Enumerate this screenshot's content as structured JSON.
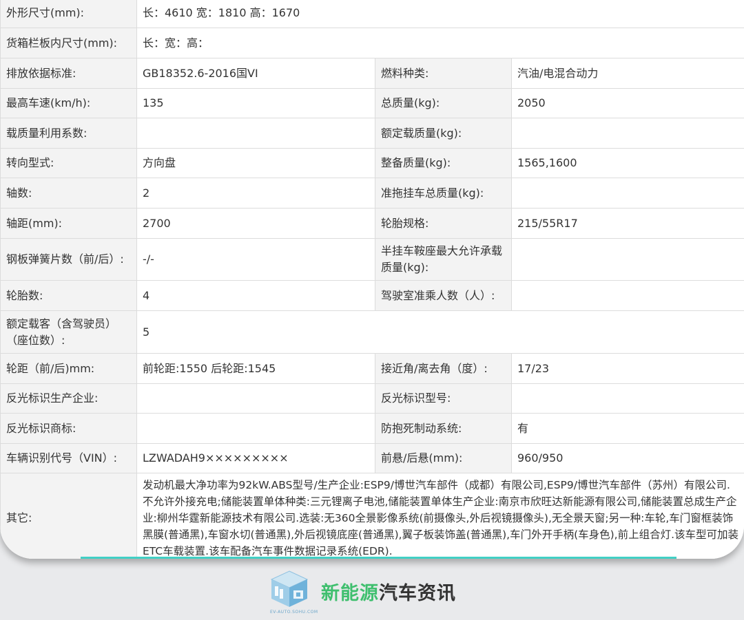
{
  "rows": [
    {
      "l1": "外形尺寸(mm):",
      "v1": "长：4610 宽：1810 高：1670"
    },
    {
      "l1": "货箱栏板内尺寸(mm):",
      "v1": "长：宽：高："
    },
    {
      "l1": "排放依据标准:",
      "v1": "GB18352.6-2016国VI",
      "l2": "燃料种类:",
      "v2": "汽油/电混合动力"
    },
    {
      "l1": "最高车速(km/h):",
      "v1": "135",
      "l2": "总质量(kg):",
      "v2": "2050"
    },
    {
      "l1": "载质量利用系数:",
      "v1": "",
      "l2": "额定载质量(kg):",
      "v2": ""
    },
    {
      "l1": "转向型式:",
      "v1": "方向盘",
      "l2": "整备质量(kg):",
      "v2": "1565,1600"
    },
    {
      "l1": "轴数:",
      "v1": "2",
      "l2": "准拖挂车总质量(kg):",
      "v2": ""
    },
    {
      "l1": "轴距(mm):",
      "v1": "2700",
      "l2": "轮胎规格:",
      "v2": "215/55R17"
    },
    {
      "l1": "钢板弹簧片数（前/后）:",
      "v1": "-/-",
      "l2": "半挂车鞍座最大允许承载质量(kg):",
      "v2": ""
    },
    {
      "l1": "轮胎数:",
      "v1": "4",
      "l2": "驾驶室准乘人数（人）:",
      "v2": ""
    },
    {
      "l1": "额定载客（含驾驶员）（座位数）:",
      "v1": "5"
    },
    {
      "l1": "轮距（前/后)mm:",
      "v1": "前轮距:1550 后轮距:1545",
      "l2": "接近角/离去角（度）:",
      "v2": "17/23"
    },
    {
      "l1": "反光标识生产企业:",
      "v1": "",
      "l2": "反光标识型号:",
      "v2": ""
    },
    {
      "l1": "反光标识商标:",
      "v1": "",
      "l2": "防抱死制动系统:",
      "v2": "有"
    },
    {
      "l1": "车辆识别代号（VIN）:",
      "v1": "LZWADAH9×××××××××",
      "l2": "前悬/后悬(mm):",
      "v2": "960/950"
    }
  ],
  "other": {
    "label": "其它:",
    "text": "发动机最大净功率为92kW.ABS型号/生产企业:ESP9/博世汽车部件（成都）有限公司,ESP9/博世汽车部件（苏州）有限公司.不允许外接充电;储能装置单体种类:三元锂离子电池,储能装置单体生产企业:南京市欣旺达新能源有限公司,储能装置总成生产企业:柳州华霆新能源技术有限公司.选装:无360全景影像系统(前摄像头,外后视镜摄像头),无全景天窗;另一种:车轮,车门窗框装饰黑膜(普通黑),车窗水切(普通黑),外后视镜底座(普通黑),翼子板装饰盖(普通黑),车门外开手柄(车身色),前上组合灯.该车型可加装ETC车载装置.该车配备汽车事件数据记录系统(EDR)."
  },
  "footer": {
    "brand_green": "新能源",
    "brand_dark": "汽车资讯",
    "small_text": "EV-AUTO.SOHU.COM"
  },
  "colors": {
    "accent": "#41d0c5",
    "brand_green": "#3fbf6e",
    "label_bg": "#f3f3f3"
  }
}
